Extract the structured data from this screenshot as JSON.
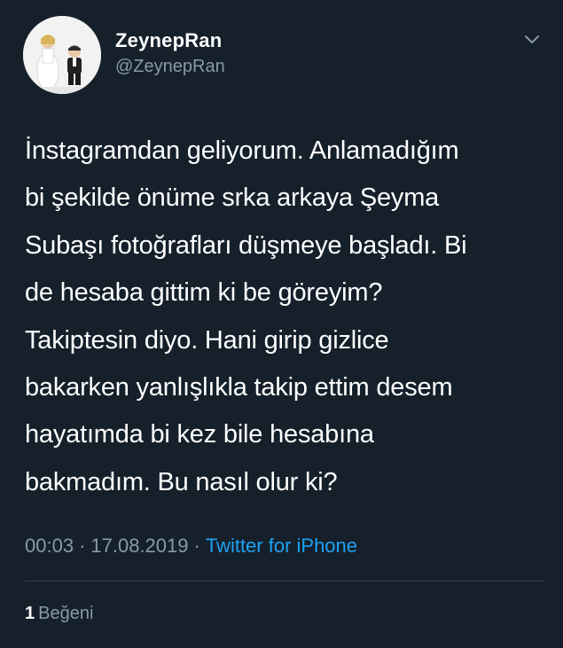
{
  "tweet": {
    "author": {
      "display_name": "ZeynepRan",
      "username": "@ZeynepRan"
    },
    "text": "İnstagramdan geliyorum. Anlamadığım\nbi şekilde önüme srka arkaya Şeyma\nSubaşı fotoğrafları düşmeye başladı. Bi\nde hesaba gittim ki be göreyim?\nTakiptesin diyo. Hani girip gizlice\nbakarken yanlışlıkla takip ettim desem\nhayatımda bi kez bile hesabına\nbakmadım. Bu nasıl olur ki?",
    "time": "00:03",
    "date": "17.08.2019",
    "separator": "·",
    "source": "Twitter for iPhone",
    "likes": {
      "count": "1",
      "label": "Beğeni"
    }
  },
  "icons": {
    "menu": "chevron-down-icon",
    "avatar": "profile-avatar"
  },
  "colors": {
    "background": "#15202b",
    "primary_text": "#ffffff",
    "secondary_text": "#8899a6",
    "link": "#1da1f2",
    "divider": "#38444d"
  }
}
